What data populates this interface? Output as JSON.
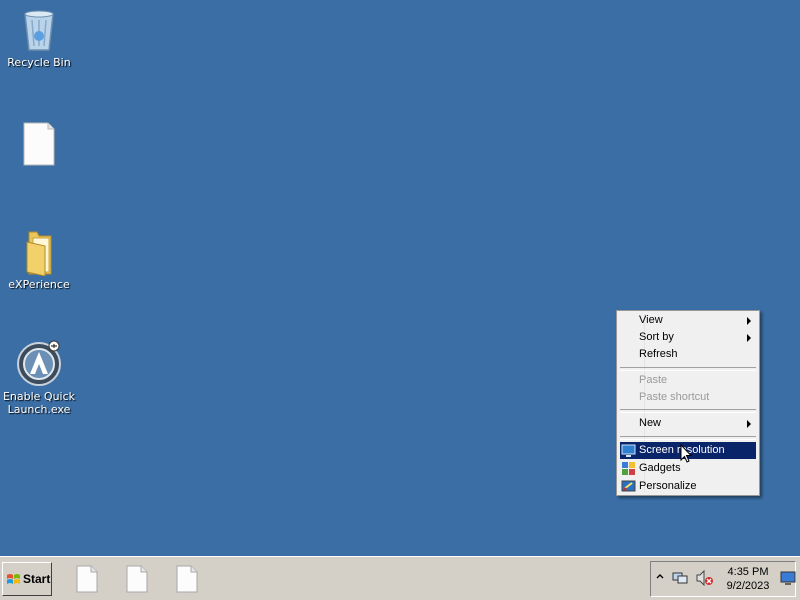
{
  "desktop": {
    "icons": [
      {
        "label": "Recycle Bin"
      },
      {
        "label": ""
      },
      {
        "label": "eXPerience"
      },
      {
        "label": "Enable Quick Launch.exe"
      }
    ]
  },
  "context_menu": {
    "items": [
      {
        "label": "View",
        "submenu": true,
        "enabled": true
      },
      {
        "label": "Sort by",
        "submenu": true,
        "enabled": true
      },
      {
        "label": "Refresh",
        "submenu": false,
        "enabled": true
      },
      {
        "label": "Paste",
        "submenu": false,
        "enabled": false
      },
      {
        "label": "Paste shortcut",
        "submenu": false,
        "enabled": false
      },
      {
        "label": "New",
        "submenu": true,
        "enabled": true
      },
      {
        "label": "Screen resolution",
        "submenu": false,
        "enabled": true,
        "highlighted": true
      },
      {
        "label": "Gadgets",
        "submenu": false,
        "enabled": true
      },
      {
        "label": "Personalize",
        "submenu": false,
        "enabled": true
      }
    ]
  },
  "taskbar": {
    "start_label": "Start",
    "clock_time": "4:35 PM",
    "clock_date": "9/2/2023"
  },
  "colors": {
    "desktop_bg": "#3a6ea5",
    "highlight": "#0a246a",
    "taskbar_bg": "#d4d0c8"
  }
}
